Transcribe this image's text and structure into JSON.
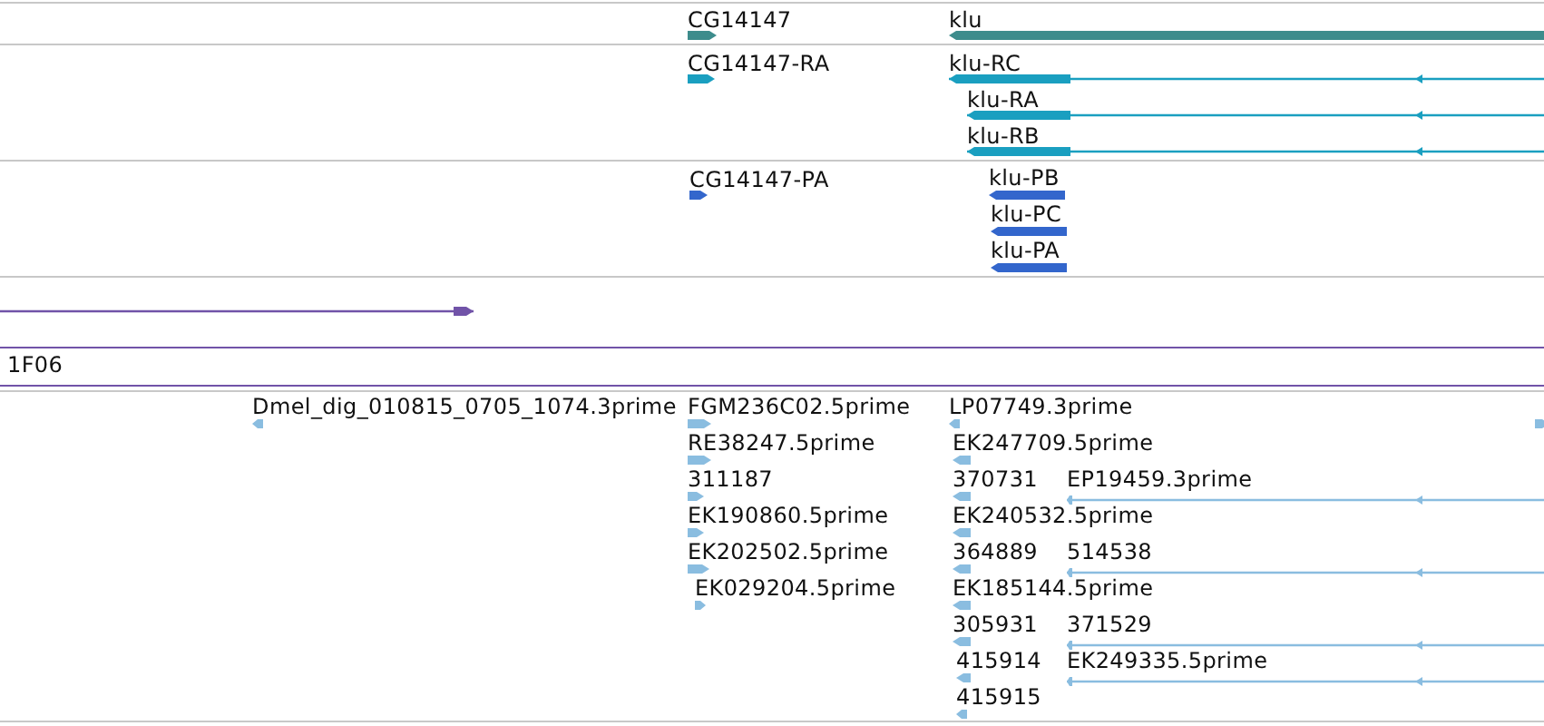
{
  "tracks": [
    {
      "color": "#3d8c8c",
      "features": [
        {
          "kind": "block",
          "forward": true,
          "label": "CG14147"
        },
        {
          "kind": "block",
          "forward": false,
          "label": "klu"
        }
      ]
    },
    {
      "color": "#1a9fc0",
      "features": [
        {
          "kind": "block",
          "forward": true,
          "label": "CG14147-RA"
        },
        {
          "kind": "spliced",
          "forward": false,
          "label": "klu-RC"
        },
        {
          "kind": "spliced",
          "forward": false,
          "label": "klu-RA"
        },
        {
          "kind": "spliced",
          "forward": false,
          "label": "klu-RB"
        }
      ]
    },
    {
      "color": "#3366cc",
      "features": [
        {
          "kind": "block",
          "forward": true,
          "label": "CG14147-PA"
        },
        {
          "kind": "block",
          "forward": false,
          "label": "klu-PB"
        },
        {
          "kind": "block",
          "forward": false,
          "label": "klu-PC"
        },
        {
          "kind": "block",
          "forward": false,
          "label": "klu-PA"
        }
      ]
    },
    {
      "color": "#7153a8",
      "features": [
        {
          "kind": "spliced",
          "forward": true
        },
        {
          "kind": "span",
          "label": "1F06"
        }
      ]
    },
    {
      "color": "#8abde0",
      "features": [
        {
          "kind": "block",
          "forward": false,
          "label": "Dmel_dig_010815_0705_1074.3prime"
        },
        {
          "kind": "block",
          "forward": true,
          "label": "FGM236C02.5prime"
        },
        {
          "kind": "block",
          "forward": true,
          "label": "RE38247.5prime"
        },
        {
          "kind": "block",
          "forward": true,
          "label": "311187"
        },
        {
          "kind": "block",
          "forward": true,
          "label": "EK190860.5prime"
        },
        {
          "kind": "block",
          "forward": true,
          "label": "EK202502.5prime"
        },
        {
          "kind": "block",
          "forward": true,
          "label": "EK029204.5prime"
        },
        {
          "kind": "block",
          "forward": false,
          "label": "LP07749.3prime"
        },
        {
          "kind": "block",
          "forward": false,
          "label": "EK247709.5prime"
        },
        {
          "kind": "block",
          "forward": false,
          "label": "370731"
        },
        {
          "kind": "block",
          "forward": false,
          "label": "EK240532.5prime"
        },
        {
          "kind": "block",
          "forward": false,
          "label": "364889"
        },
        {
          "kind": "block",
          "forward": false,
          "label": "EK185144.5prime"
        },
        {
          "kind": "block",
          "forward": false,
          "label": "305931"
        },
        {
          "kind": "block",
          "forward": false,
          "label": "415914"
        },
        {
          "kind": "block",
          "forward": false,
          "label": "415915"
        },
        {
          "kind": "spliced",
          "forward": false,
          "label": "EP19459.3prime"
        },
        {
          "kind": "spliced",
          "forward": false,
          "label": "514538"
        },
        {
          "kind": "spliced",
          "forward": false,
          "label": "371529"
        },
        {
          "kind": "spliced",
          "forward": false,
          "label": "EK249335.5prime"
        },
        {
          "kind": "block",
          "forward": true
        }
      ]
    }
  ]
}
